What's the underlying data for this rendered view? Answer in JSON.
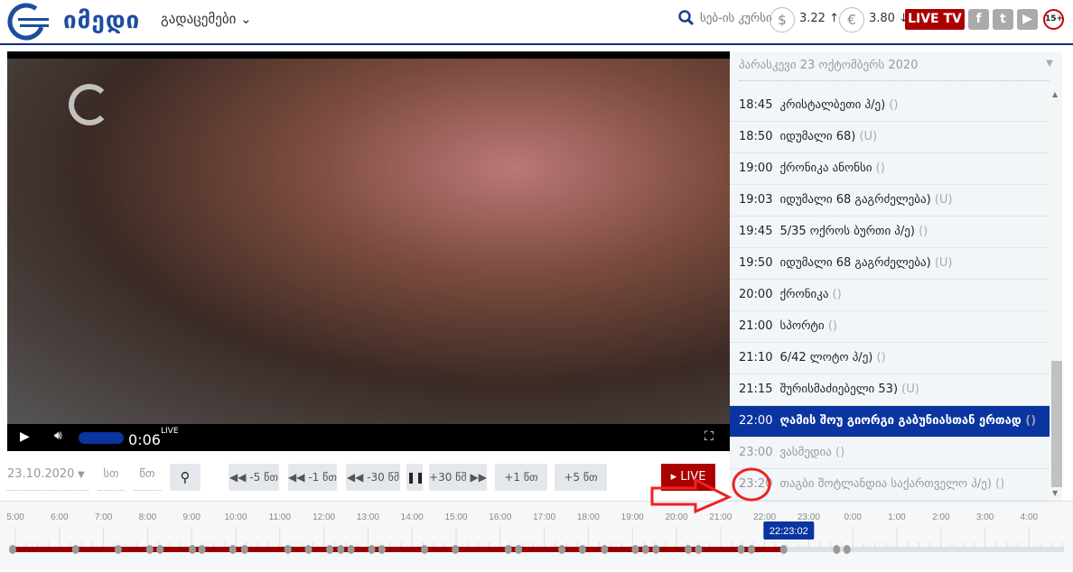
{
  "header": {
    "logo_text": "იმედი",
    "menu_label": "გადაცემები",
    "search_icon": "search-icon",
    "currency_label": "სებ-ის კურსი",
    "usd": {
      "symbol": "$",
      "rate": "3.22",
      "trend": "↑"
    },
    "eur": {
      "symbol": "€",
      "rate": "3.80",
      "trend": "↓"
    },
    "live_tv": "LIVE TV",
    "social": [
      "facebook-icon",
      "twitter-icon",
      "youtube-icon"
    ],
    "age_rating": "15+"
  },
  "player": {
    "time": "0:06",
    "live_badge": "LIVE",
    "volume_percent": 100
  },
  "schedule": {
    "date_title": "პარასკევი 23 ოქტომბერს 2020",
    "items": [
      {
        "time": "18:45",
        "title": "კრისტალბეთი პ/ე)",
        "suffix": "()",
        "state": "past"
      },
      {
        "time": "18:50",
        "title": "იდუმალი 68)",
        "suffix": "(U)",
        "state": "past"
      },
      {
        "time": "19:00",
        "title": "ქრონიკა ანონსი",
        "suffix": "()",
        "state": "past"
      },
      {
        "time": "19:03",
        "title": "იდუმალი 68 გაგრძელება)",
        "suffix": "(U)",
        "state": "past"
      },
      {
        "time": "19:45",
        "title": "5/35 ოქროს ბურთი პ/ე)",
        "suffix": "()",
        "state": "past"
      },
      {
        "time": "19:50",
        "title": "იდუმალი 68 გაგრძელება)",
        "suffix": "(U)",
        "state": "past"
      },
      {
        "time": "20:00",
        "title": "ქრონიკა",
        "suffix": "()",
        "state": "past"
      },
      {
        "time": "21:00",
        "title": "სპორტი",
        "suffix": "()",
        "state": "past"
      },
      {
        "time": "21:10",
        "title": "6/42 ლოტო პ/ე)",
        "suffix": "()",
        "state": "past"
      },
      {
        "time": "21:15",
        "title": "შურისმაძიებელი 53)",
        "suffix": "(U)",
        "state": "past"
      },
      {
        "time": "22:00",
        "title": "ღამის შოუ გიორგი გაბუნიასთან ერთად",
        "suffix": "()",
        "state": "current"
      },
      {
        "time": "23:00",
        "title": "ვასმედია",
        "suffix": "()",
        "state": "future"
      },
      {
        "time": "23:20",
        "title": "თაგბი შოტლანდია საქართველო პ/ე)",
        "suffix": "()",
        "state": "future"
      }
    ]
  },
  "controls": {
    "date": "23.10.2020",
    "hour_placeholder": "სთ",
    "minute_placeholder": "წთ",
    "buttons": [
      "-5 წთ",
      "-1 წთ",
      "-30 წმ",
      "+30 წმ",
      "+1 წთ",
      "+5 წთ"
    ],
    "live": "LIVE"
  },
  "timeline": {
    "ticks": [
      "5:00",
      "6:00",
      "7:00",
      "8:00",
      "9:00",
      "10:00",
      "11:00",
      "12:00",
      "13:00",
      "14:00",
      "15:00",
      "16:00",
      "17:00",
      "18:00",
      "19:00",
      "20:00",
      "21:00",
      "22:00",
      "23:00",
      "0:00",
      "1:00",
      "2:00",
      "3:00",
      "4:00"
    ],
    "current_time": "22:23:02",
    "played_until": "22:23",
    "markers": [
      "4:56",
      "6:22",
      "7:20",
      "8:03",
      "8:17",
      "9:01",
      "9:14",
      "9:56",
      "10:12",
      "11:11",
      "11:39",
      "12:08",
      "12:23",
      "12:37",
      "13:05",
      "13:19",
      "14:17",
      "14:59",
      "16:11",
      "16:25",
      "17:24",
      "17:52",
      "18:22",
      "19:04",
      "19:18",
      "19:32",
      "20:16",
      "20:30",
      "21:28",
      "21:42",
      "22:26",
      "23:38",
      "23:52"
    ],
    "colors": {
      "played": "#990000",
      "remaining": "#dde2e5",
      "marker": "#999999",
      "cursor": "#0a34a0"
    }
  }
}
